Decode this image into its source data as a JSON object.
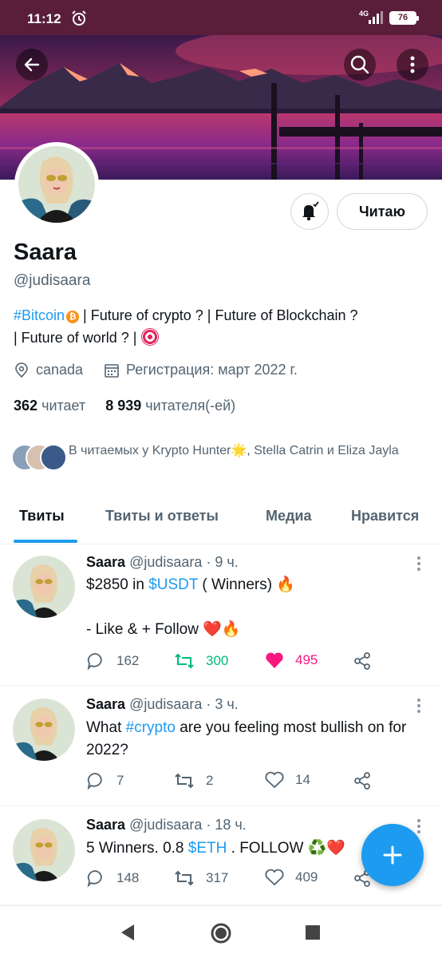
{
  "status_bar": {
    "time": "11:12",
    "network": "4G",
    "battery": "76"
  },
  "profile": {
    "name": "Saara",
    "handle": "@judisaara",
    "follow_button": "Читаю",
    "bio": {
      "hashtag": "#Bitcoin",
      "line1_rest": " | Future of crypto ? | Future of Blockchain ?",
      "line2": "| Future of world ? |"
    },
    "location": "canada",
    "joined": "Регистрация: март 2022 г.",
    "following_count": "362",
    "following_label": "читает",
    "followers_count": "8 939",
    "followers_label": "читателя(-ей)",
    "followed_by": "В читаемых у Krypto Hunter🌟, Stella Catrin и Eliza Jayla"
  },
  "tabs": [
    "Твиты",
    "Твиты и ответы",
    "Медиа",
    "Нравится"
  ],
  "tweets": [
    {
      "name": "Saara",
      "meta": "@judisaara · 9 ч.",
      "text_pre": "$2850 in ",
      "text_link": "$USDT",
      "text_post": " ( Winners) 🔥",
      "text_line2": "- Like & + Follow ❤️🔥",
      "replies": "162",
      "retweets": "300",
      "likes": "495"
    },
    {
      "name": "Saara",
      "meta": "@judisaara · 3 ч.",
      "text_pre": "What ",
      "text_link": "#crypto",
      "text_post": " are you feeling most bullish on for 2022?",
      "replies": "7",
      "retweets": "2",
      "likes": "14"
    },
    {
      "name": "Saara",
      "meta": "@judisaara · 18 ч.",
      "text_pre": "5 Winners. 0.8 ",
      "text_link": "$ETH",
      "text_post": " . FOLLOW ♻️❤️",
      "replies": "148",
      "retweets": "317",
      "likes": "409"
    }
  ],
  "colors": {
    "accent": "#1d9bf0",
    "retweet": "#00ba7c",
    "like": "#f91880",
    "text": "#0f1419",
    "muted": "#536471"
  }
}
